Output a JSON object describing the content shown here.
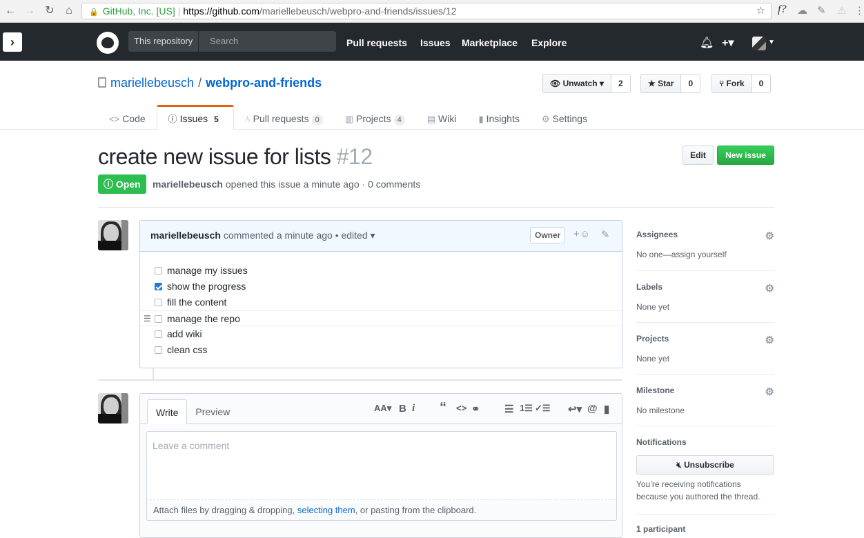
{
  "browser": {
    "org": "GitHub, Inc. [US]",
    "url_host": "https://github.com",
    "url_path": "/mariellebeusch/webpro-and-friends/issues/12",
    "ext_label": "f?"
  },
  "header": {
    "scope_label": "This repository",
    "search_placeholder": "Search",
    "nav": [
      "Pull requests",
      "Issues",
      "Marketplace",
      "Explore"
    ]
  },
  "repo": {
    "owner": "mariellebeusch",
    "name": "webpro-and-friends",
    "watch_label": "Unwatch",
    "watch_count": "2",
    "star_label": "Star",
    "star_count": "0",
    "fork_label": "Fork",
    "fork_count": "0"
  },
  "tabs": [
    {
      "label": "Code",
      "count": ""
    },
    {
      "label": "Issues",
      "count": "5"
    },
    {
      "label": "Pull requests",
      "count": "0"
    },
    {
      "label": "Projects",
      "count": "4"
    },
    {
      "label": "Wiki",
      "count": ""
    },
    {
      "label": "Insights",
      "count": ""
    },
    {
      "label": "Settings",
      "count": ""
    }
  ],
  "issue": {
    "title": "create new issue for lists",
    "number": "#12",
    "edit_label": "Edit",
    "new_label": "New issue",
    "state": "Open",
    "author": "mariellebeusch",
    "opened_text": "opened this issue a minute ago · 0 comments"
  },
  "comment": {
    "author": "mariellebeusch",
    "meta": "commented a minute ago • edited",
    "owner_label": "Owner",
    "tasks": [
      {
        "label": "manage my issues",
        "checked": false
      },
      {
        "label": "show the progress",
        "checked": true
      },
      {
        "label": "fill the content",
        "checked": false
      },
      {
        "label": "manage the repo",
        "checked": false
      },
      {
        "label": "add wiki",
        "checked": false
      },
      {
        "label": "clean css",
        "checked": false
      }
    ]
  },
  "form": {
    "write_tab": "Write",
    "preview_tab": "Preview",
    "placeholder": "Leave a comment",
    "attach_pre": "Attach files by dragging & dropping, ",
    "attach_link": "selecting them",
    "attach_post": ", or pasting from the clipboard."
  },
  "sidebar": {
    "assignees_title": "Assignees",
    "assignees_value": "No one—assign yourself",
    "labels_title": "Labels",
    "labels_value": "None yet",
    "projects_title": "Projects",
    "projects_value": "None yet",
    "milestone_title": "Milestone",
    "milestone_value": "No milestone",
    "notifications_title": "Notifications",
    "unsubscribe_label": "Unsubscribe",
    "notif_text": "You’re receiving notifications because you authored the thread.",
    "participants": "1 participant"
  }
}
